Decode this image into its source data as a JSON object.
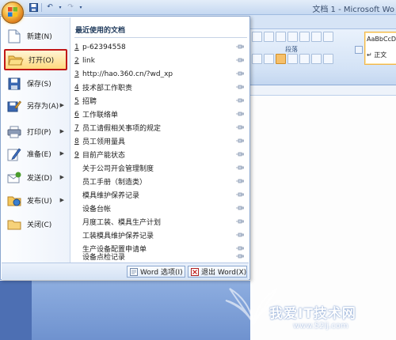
{
  "window": {
    "title": "文档 1 - Microsoft Wo"
  },
  "ribbon": {
    "group_label": "段落",
    "style_sample": "AaBbCcDc",
    "style_name": "↵ 正文"
  },
  "menu": {
    "commands": [
      {
        "label": "新建(N)",
        "icon": "new-document-icon",
        "submenu": false
      },
      {
        "label": "打开(O)",
        "icon": "open-folder-icon",
        "submenu": false
      },
      {
        "label": "保存(S)",
        "icon": "save-disk-icon",
        "submenu": false
      },
      {
        "label": "另存为(A)",
        "icon": "save-as-icon",
        "submenu": true
      },
      {
        "label": "打印(P)",
        "icon": "printer-icon",
        "submenu": true
      },
      {
        "label": "准备(E)",
        "icon": "prepare-pen-icon",
        "submenu": true
      },
      {
        "label": "发送(D)",
        "icon": "send-icon",
        "submenu": true
      },
      {
        "label": "发布(U)",
        "icon": "publish-icon",
        "submenu": true
      },
      {
        "label": "关闭(C)",
        "icon": "close-folder-icon",
        "submenu": false
      }
    ],
    "recent_title": "最近使用的文档",
    "recent_documents": [
      {
        "num": "1",
        "name": "p-62394558"
      },
      {
        "num": "2",
        "name": "link"
      },
      {
        "num": "3",
        "name": "http://hao.360.cn/?wd_xp"
      },
      {
        "num": "4",
        "name": "技术部工作职责"
      },
      {
        "num": "5",
        "name": "招聘"
      },
      {
        "num": "6",
        "name": "工作联络单"
      },
      {
        "num": "7",
        "name": "员工请假相关事项的规定"
      },
      {
        "num": "8",
        "name": "员工领用量具"
      },
      {
        "num": "9",
        "name": "目前产能状态"
      },
      {
        "num": "",
        "name": "关于公司开会管理制度"
      },
      {
        "num": "",
        "name": "员工手册（制造类）"
      },
      {
        "num": "",
        "name": "模具维护保养记录"
      },
      {
        "num": "",
        "name": "设备台帐"
      },
      {
        "num": "",
        "name": "月度工装、模具生产计划"
      },
      {
        "num": "",
        "name": "工装模具维护保养记录"
      },
      {
        "num": "",
        "name": "生产设备配置申请单"
      },
      {
        "num": "",
        "name": "设备点检记录"
      }
    ],
    "footer": {
      "options_label": "Word 选项(I)",
      "exit_label": "退出 Word(X)"
    }
  },
  "watermark": {
    "text": "我爱IT技术网",
    "url": "www.52ij.com"
  },
  "colors": {
    "highlight_border": "#c11818",
    "highlight_fill": "#ffd97e",
    "menu_border": "#8aa6cf"
  }
}
